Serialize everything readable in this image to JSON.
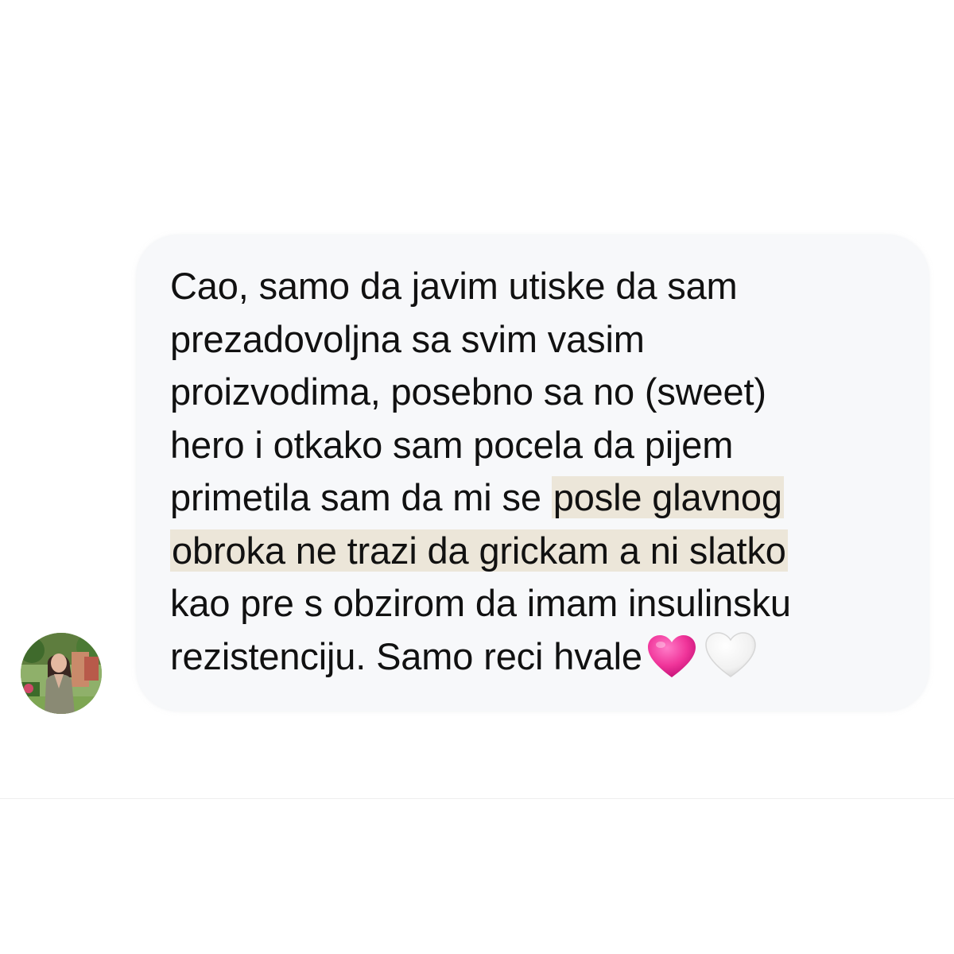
{
  "message": {
    "lines": [
      "Cao, samo da javim utiske da sam",
      "prezadovoljna sa svim vasim",
      "proizvodima, posebno sa no (sweet)",
      "hero i otkako sam pocela da pijem",
      "primetila sam da mi se ",
      "posle glavnog",
      "obroka ne trazi da grickam a ni slatko",
      "kao pre s obzirom da imam insulinsku",
      "rezistenciju. Samo reci hvale"
    ],
    "emojis": [
      "pink-heart-icon",
      "white-heart-icon"
    ]
  },
  "colors": {
    "bubble": "#f7f8fa",
    "highlight": "#ece6d9",
    "text": "#111111",
    "pink_heart": "#f0359a"
  }
}
